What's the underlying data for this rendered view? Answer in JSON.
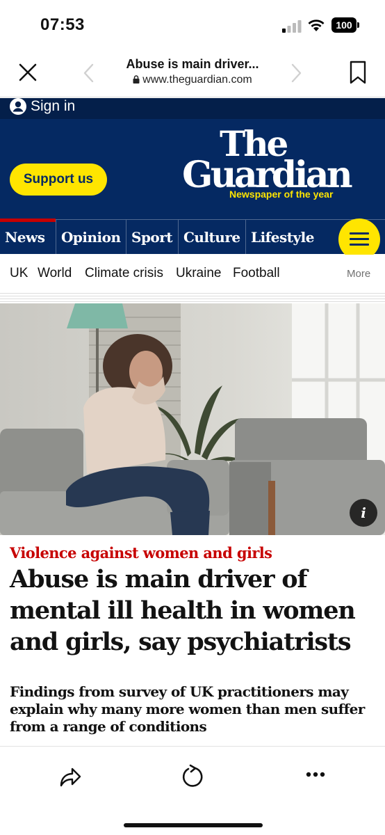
{
  "status_bar": {
    "time": "07:53",
    "battery": "100"
  },
  "browser": {
    "title": "Abuse is main driver...",
    "url": "www.theguardian.com"
  },
  "header": {
    "sign_in": "Sign in",
    "support_label": "Support us",
    "logo_line1": "The",
    "logo_line2": "Guardian",
    "tagline": "Newspaper of the year"
  },
  "pillars": [
    "News",
    "Opinion",
    "Sport",
    "Culture",
    "Lifestyle"
  ],
  "subnav": {
    "items": [
      "UK",
      "World",
      "Climate crisis",
      "Ukraine",
      "Football"
    ],
    "more": "More"
  },
  "hero": {
    "info_label": "i"
  },
  "article": {
    "kicker": "Violence against women and girls",
    "headline": "Abuse is main driver of mental ill health in women and girls, say psychiatrists",
    "standfirst": "Findings from survey of UK practitioners may explain why many more women than men suffer from a range of conditions"
  },
  "colors": {
    "brand_blue": "#052962",
    "support_yellow": "#ffe500",
    "news_red": "#c70000"
  },
  "icons": [
    "close-icon",
    "back-chevron-icon",
    "forward-chevron-icon",
    "bookmark-icon",
    "lock-icon",
    "user-icon",
    "menu-icon",
    "info-icon",
    "share-icon",
    "reload-icon",
    "more-icon"
  ]
}
